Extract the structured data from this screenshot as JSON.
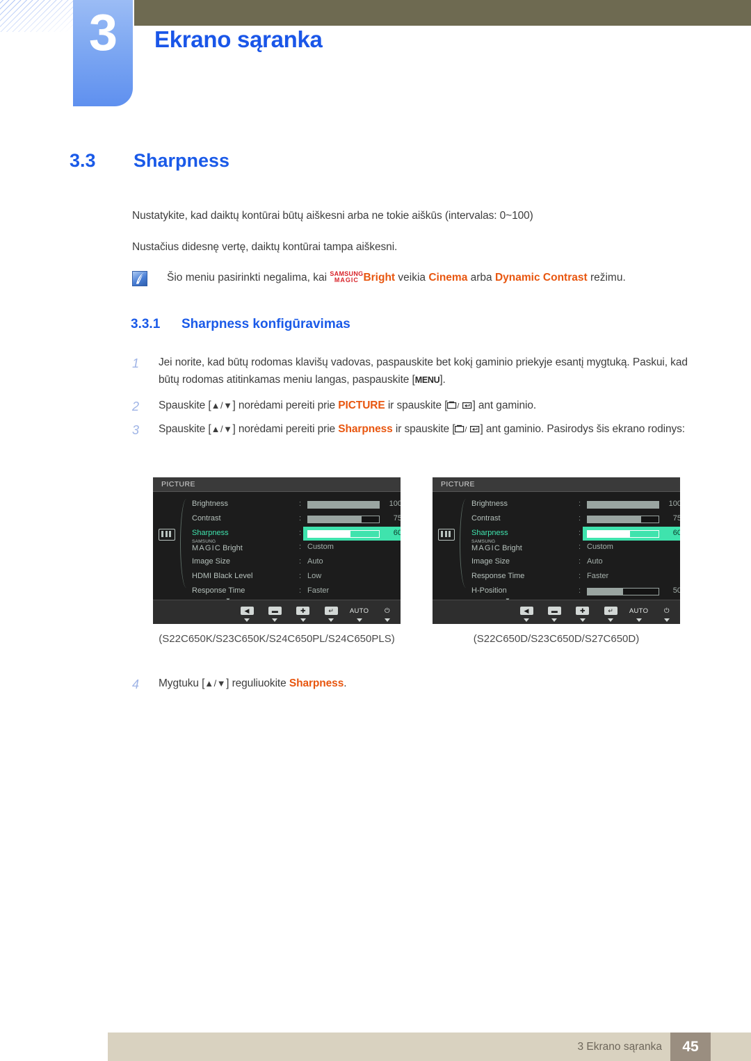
{
  "header": {
    "chapter_number": "3",
    "chapter_title": "Ekrano sąranka"
  },
  "section": {
    "number": "3.3",
    "title": "Sharpness"
  },
  "paragraphs": {
    "p1": "Nustatykite, kad daiktų kontūrai būtų aiškesni arba ne tokie aiškūs (intervalas: 0~100)",
    "p2": "Nustačius didesnę vertę, daiktų kontūrai tampa aiškesni."
  },
  "note": {
    "icon": "note-pen-icon",
    "text_before": "Šio meniu pasirinkti negalima, kai ",
    "magic_top": "SAMSUNG",
    "magic_bottom": "MAGIC",
    "bright": "Bright",
    "text_mid": " veikia ",
    "mode1": "Cinema",
    "text_or": " arba ",
    "mode2": "Dynamic Contrast",
    "text_end": " režimu."
  },
  "subsection": {
    "number": "3.3.1",
    "title": "Sharpness konfigūravimas"
  },
  "steps": [
    {
      "num": "1",
      "part1": "Jei norite, kad būtų rodomas klavišų vadovas, paspauskite bet kokį gaminio priekyje esantį mygtuką. Paskui, kad būtų rodomas atitinkamas meniu langas, paspauskite [",
      "key": "MENU",
      "part2": "]."
    },
    {
      "num": "2",
      "part1": "Spauskite [",
      "arrows": "▲/▼",
      "part2": "] norėdami pereiti prie ",
      "highlight": "PICTURE",
      "part3": " ir spauskite [",
      "part4": "] ant gaminio."
    },
    {
      "num": "3",
      "part1": "Spauskite [",
      "arrows": "▲/▼",
      "part2": "] norėdami pereiti prie ",
      "highlight": "Sharpness",
      "part3": " ir spauskite [",
      "part4": "] ant gaminio. Pasirodys šis ekrano rodinys:"
    },
    {
      "num": "4",
      "part1": "Mygtuku [",
      "arrows": "▲/▼",
      "part2": "] reguliuokite ",
      "highlight": "Sharpness",
      "part3": "."
    }
  ],
  "osd_left": {
    "title": "PICTURE",
    "sidebar_icon": "picture-menu-icon",
    "rows": [
      {
        "label": "Brightness",
        "type": "slider",
        "value": "100",
        "percent": 100,
        "highlight": false
      },
      {
        "label": "Contrast",
        "type": "slider",
        "value": "75",
        "percent": 75,
        "highlight": false
      },
      {
        "label": "Sharpness",
        "type": "slider",
        "value": "60",
        "percent": 60,
        "highlight": true
      },
      {
        "label": "MAGICBright",
        "type": "magic",
        "value": "Custom",
        "highlight": false
      },
      {
        "label": "Image Size",
        "type": "text",
        "value": "Auto",
        "highlight": false
      },
      {
        "label": "HDMI Black Level",
        "type": "text",
        "value": "Low",
        "highlight": false
      },
      {
        "label": "Response Time",
        "type": "text",
        "value": "Faster",
        "highlight": false
      }
    ],
    "more_indicator": "▼",
    "buttons": [
      {
        "name": "back-button",
        "glyph": "◀",
        "type": "cap"
      },
      {
        "name": "minus-button",
        "glyph": "▬",
        "type": "cap"
      },
      {
        "name": "plus-button",
        "glyph": "✚",
        "type": "cap"
      },
      {
        "name": "enter-button",
        "glyph": "↵",
        "type": "cap"
      },
      {
        "name": "auto-button",
        "glyph": "AUTO",
        "type": "text"
      },
      {
        "name": "power-button",
        "glyph": "⏻",
        "type": "text"
      }
    ],
    "caption": "(S22C650K/S23C650K/S24C650PL/S24C650PLS)"
  },
  "osd_right": {
    "title": "PICTURE",
    "sidebar_icon": "picture-menu-icon",
    "rows": [
      {
        "label": "Brightness",
        "type": "slider",
        "value": "100",
        "percent": 100,
        "highlight": false
      },
      {
        "label": "Contrast",
        "type": "slider",
        "value": "75",
        "percent": 75,
        "highlight": false
      },
      {
        "label": "Sharpness",
        "type": "slider",
        "value": "60",
        "percent": 60,
        "highlight": true
      },
      {
        "label": "MAGICBright",
        "type": "magic",
        "value": "Custom",
        "highlight": false
      },
      {
        "label": "Image Size",
        "type": "text",
        "value": "Auto",
        "highlight": false
      },
      {
        "label": "Response Time",
        "type": "text",
        "value": "Faster",
        "highlight": false
      },
      {
        "label": "H-Position",
        "type": "slider",
        "value": "50",
        "percent": 50,
        "highlight": false
      }
    ],
    "more_indicator": "▼",
    "caption": "(S22C650D/S23C650D/S27C650D)"
  },
  "magic_label": {
    "top": "SAMSUNG",
    "bottom": "MAGIC",
    "suffix": "Bright"
  },
  "footer": {
    "text": "3 Ekrano sąranka",
    "page": "45"
  },
  "colors": {
    "heading_blue": "#1a5ae8",
    "accent_orange": "#e8560f",
    "magic_red": "#d8232a",
    "olive": "#6e6a51",
    "chapter_blue": "#7ea8f2",
    "osd_green": "#3fe3ad",
    "footer_beige": "#d9d2c0",
    "footer_page_bg": "#9a8e80"
  }
}
